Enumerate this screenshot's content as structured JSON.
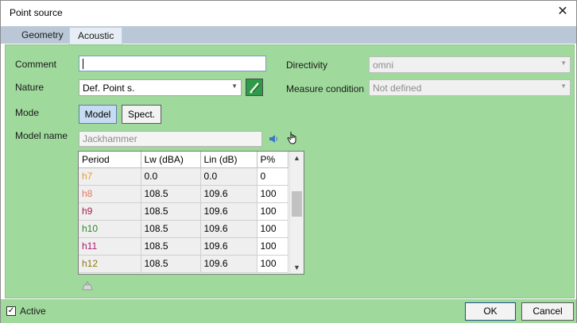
{
  "window": {
    "title": "Point source",
    "close_glyph": "✕"
  },
  "tabs": [
    {
      "label": "Geometry"
    },
    {
      "label": "Acoustic"
    }
  ],
  "form": {
    "comment_label": "Comment",
    "comment_value": "",
    "nature_label": "Nature",
    "nature_value": "Def. Point s.",
    "mode_label": "Mode",
    "mode_model": "Model",
    "mode_spect": "Spect.",
    "model_name_label": "Model name",
    "model_name_value": "Jackhammer",
    "directivity_label": "Directivity",
    "directivity_value": "omni",
    "measure_label": "Measure condition",
    "measure_value": "Not defined"
  },
  "grid": {
    "headers": [
      "Period",
      "Lw (dBA)",
      "Lin (dB)",
      "P%"
    ],
    "rows": [
      {
        "period": "h7",
        "lw": "0.0",
        "lin": "0.0",
        "p": "0",
        "color": "#e0a030"
      },
      {
        "period": "h8",
        "lw": "108.5",
        "lin": "109.6",
        "p": "100",
        "color": "#e07860"
      },
      {
        "period": "h9",
        "lw": "108.5",
        "lin": "109.6",
        "p": "100",
        "color": "#a0204a"
      },
      {
        "period": "h10",
        "lw": "108.5",
        "lin": "109.6",
        "p": "100",
        "color": "#2a8a2a"
      },
      {
        "period": "h11",
        "lw": "108.5",
        "lin": "109.6",
        "p": "100",
        "color": "#b01870"
      },
      {
        "period": "h12",
        "lw": "108.5",
        "lin": "109.6",
        "p": "100",
        "color": "#8a7a10"
      }
    ]
  },
  "footer": {
    "active_label": "Active",
    "active_checked": true,
    "ok_label": "OK",
    "cancel_label": "Cancel"
  },
  "colors": {
    "panel": "#9fd99c",
    "tabstrip": "#b9c7d7"
  }
}
